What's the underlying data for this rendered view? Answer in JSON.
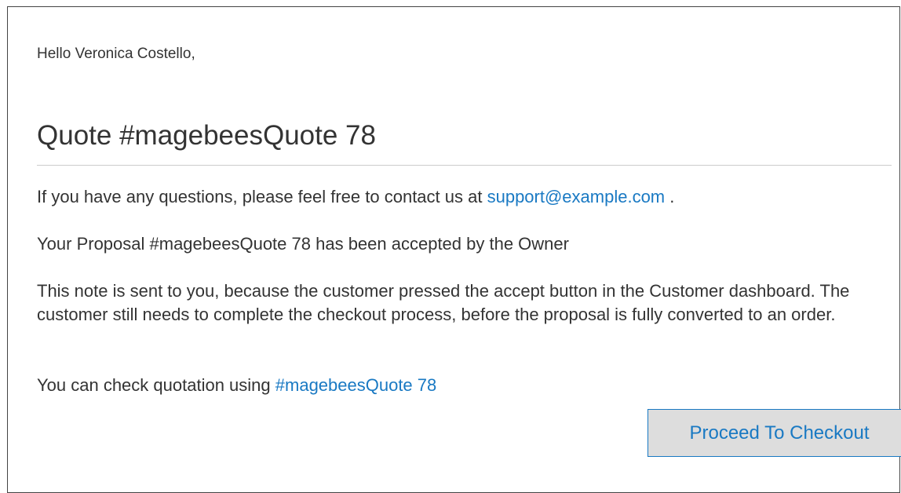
{
  "email": {
    "greeting": "Hello Veronica Costello,",
    "title": "Quote #magebeesQuote 78",
    "contact": {
      "prefix": "If you have any questions, please feel free to contact us at",
      "email_link": "support@example.com",
      "suffix": "."
    },
    "accepted_message": "Your Proposal #magebeesQuote 78 has been accepted by the Owner",
    "note": "This note is sent to you, because the customer pressed the accept button in the Customer dashboard. The customer still needs to complete the checkout process, before the proposal is fully converted to an order.",
    "check": {
      "prefix": "You can check quotation using",
      "quote_link": "#magebeesQuote 78"
    },
    "checkout_button_label": "Proceed To Checkout"
  },
  "colors": {
    "link": "#1979c3",
    "text": "#333333",
    "button_background": "#dddddd",
    "divider": "#cccccc"
  }
}
